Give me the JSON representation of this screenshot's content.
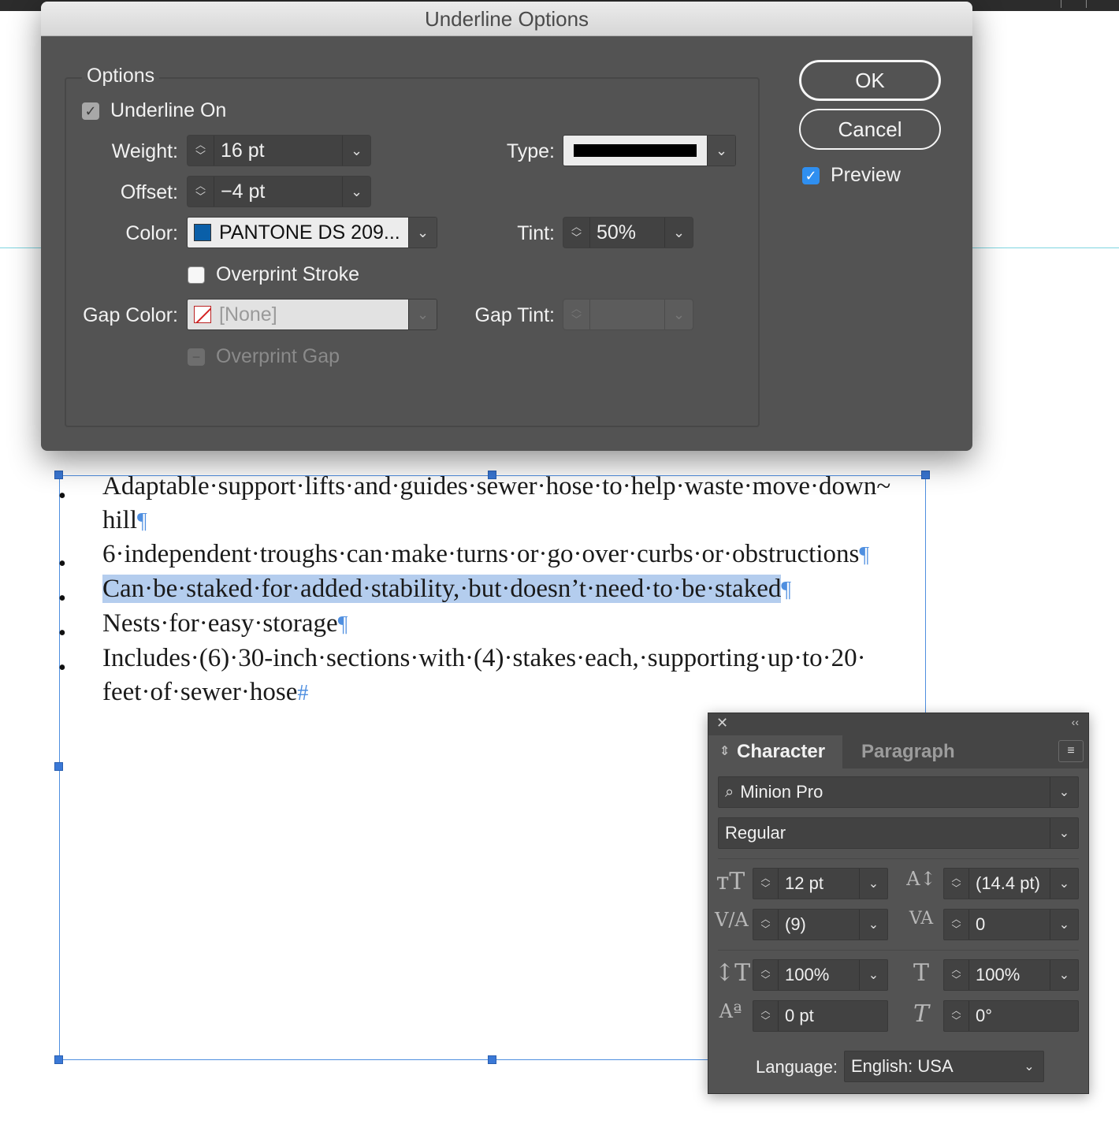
{
  "document": {
    "bullets": [
      {
        "text": "Adaptable·support·lifts·and·guides·sewer·hose·to·help·waste·move·down~ hill",
        "mark": "¶",
        "selected": false
      },
      {
        "text": "6·independent·troughs·can·make·turns·or·go·over·curbs·or·obstructions",
        "mark": "¶",
        "selected": false
      },
      {
        "text": "Can·be·staked·for·added·stability,·but·doesn’t·need·to·be·staked",
        "mark": "¶",
        "selected": true
      },
      {
        "text": "Nests·for·easy·storage",
        "mark": "¶",
        "selected": false
      },
      {
        "text": "Includes·(6)·30-inch·sections·with·(4)·stakes·each,·supporting·up·to·20· feet·of·sewer·hose",
        "mark": "#",
        "selected": false
      }
    ],
    "bullet_glyph": "•"
  },
  "dialog": {
    "title": "Underline Options",
    "group_title": "Options",
    "underline_on": {
      "label": "Underline On",
      "checked": true
    },
    "weight": {
      "label": "Weight:",
      "value": "16 pt"
    },
    "offset": {
      "label": "Offset:",
      "value": "−4 pt"
    },
    "color": {
      "label": "Color:",
      "value": "PANTONE DS 209...",
      "swatch": "#0a5fa8"
    },
    "overprint_stroke": {
      "label": "Overprint Stroke",
      "checked": false
    },
    "gap_color": {
      "label": "Gap Color:",
      "value": "[None]"
    },
    "overprint_gap": {
      "label": "Overprint Gap",
      "checked": false,
      "disabled": true
    },
    "type": {
      "label": "Type:"
    },
    "tint": {
      "label": "Tint:",
      "value": "50%"
    },
    "gap_tint": {
      "label": "Gap Tint:",
      "value": ""
    },
    "ok_label": "OK",
    "cancel_label": "Cancel",
    "preview": {
      "label": "Preview",
      "checked": true
    }
  },
  "character_panel": {
    "tabs": [
      "Character",
      "Paragraph"
    ],
    "active_tab": "Character",
    "font_family": "Minion Pro",
    "font_style": "Regular",
    "font_size": "12 pt",
    "leading": "(14.4 pt)",
    "kerning": "(9)",
    "tracking": "0",
    "vertical_scale": "100%",
    "horizontal_scale": "100%",
    "baseline_shift": "0 pt",
    "skew": "0°",
    "language_label": "Language:",
    "language": "English: USA"
  }
}
